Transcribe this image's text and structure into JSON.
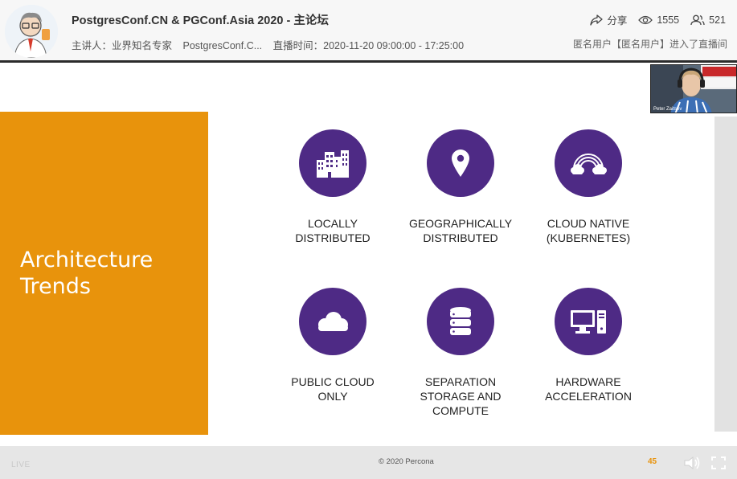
{
  "header": {
    "title": "PostgresConf.CN & PGConf.Asia 2020 - 主论坛",
    "speaker": "主讲人：业界知名专家",
    "org": "PostgresConf.C...",
    "time": "直播时间：2020-11-20 09:00:00 - 17:25:00",
    "share_label": "分享",
    "views": "1555",
    "participants": "521",
    "notice": "匿名用户【匿名用户】进入了直播间"
  },
  "slide": {
    "heading": "Architecture\nTrends",
    "tiles": [
      {
        "label": "LOCALLY\nDISTRIBUTED",
        "icon": "buildings-icon"
      },
      {
        "label": "GEOGRAPHICALLY\nDISTRIBUTED",
        "icon": "map-pin-icon"
      },
      {
        "label": "CLOUD NATIVE\n(KUBERNETES)",
        "icon": "rainbow-clouds-icon"
      },
      {
        "label": "PUBLIC CLOUD\nONLY",
        "icon": "cloud-icon"
      },
      {
        "label": "SEPARATION\nSTORAGE AND\nCOMPUTE",
        "icon": "database-icon"
      },
      {
        "label": "HARDWARE\nACCELERATION",
        "icon": "computer-icon"
      }
    ],
    "copyright": "© 2020 Percona",
    "page_number": "45"
  },
  "webcam": {
    "name_label": "Peter Zaitsev"
  },
  "footer": {
    "live_label": "LIVE"
  },
  "colors": {
    "accent_orange": "#e8930c",
    "icon_purple": "#4e2a85"
  }
}
